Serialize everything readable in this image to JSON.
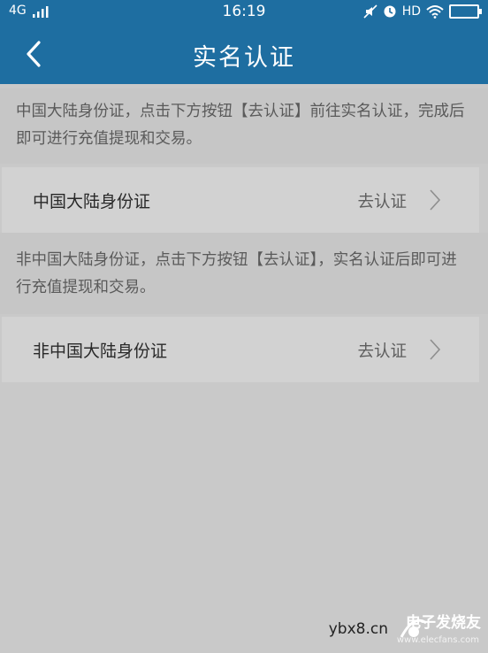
{
  "status_bar": {
    "network": "4G",
    "time": "16:19",
    "hd": "HD",
    "icons": [
      "signal-icon",
      "mute-icon",
      "alarm-icon",
      "wifi-icon",
      "battery-icon"
    ]
  },
  "nav": {
    "title": "实名认证",
    "back_icon": "back-chevron-icon"
  },
  "sections": [
    {
      "note": "中国大陆身份证，点击下方按钮【去认证】前往实名认证，完成后即可进行充值提现和交易。",
      "label": "中国大陆身份证",
      "action": "去认证"
    },
    {
      "note": "非中国大陆身份证，点击下方按钮【去认证】，实名认证后即可进行充值提现和交易。",
      "label": "非中国大陆身份证",
      "action": "去认证"
    }
  ],
  "watermark": {
    "left_text": "ybx8.cn",
    "brand": "电子发烧友",
    "url": "www.elecfans.com"
  },
  "colors": {
    "header": "#1e6ea1",
    "background": "#c9c9c9",
    "row": "#d2d2d2"
  }
}
